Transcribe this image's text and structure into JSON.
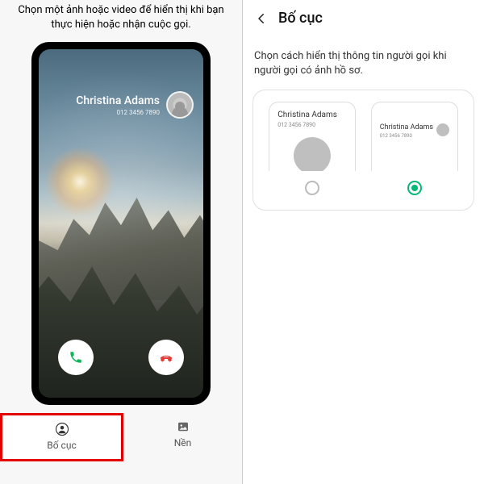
{
  "left": {
    "intro": "Chọn một ảnh hoặc video để hiển thị khi bạn thực hiện hoặc nhận cuộc gọi.",
    "caller_name": "Christina Adams",
    "caller_number": "012 3456 7890",
    "tab_layout": "Bố cục",
    "tab_background": "Nền"
  },
  "right": {
    "title": "Bố cục",
    "desc": "Chọn cách hiển thị thông tin người gọi khi người gọi có ảnh hồ sơ.",
    "opt_name": "Christina Adams",
    "opt_number": "012 3456 7890"
  }
}
